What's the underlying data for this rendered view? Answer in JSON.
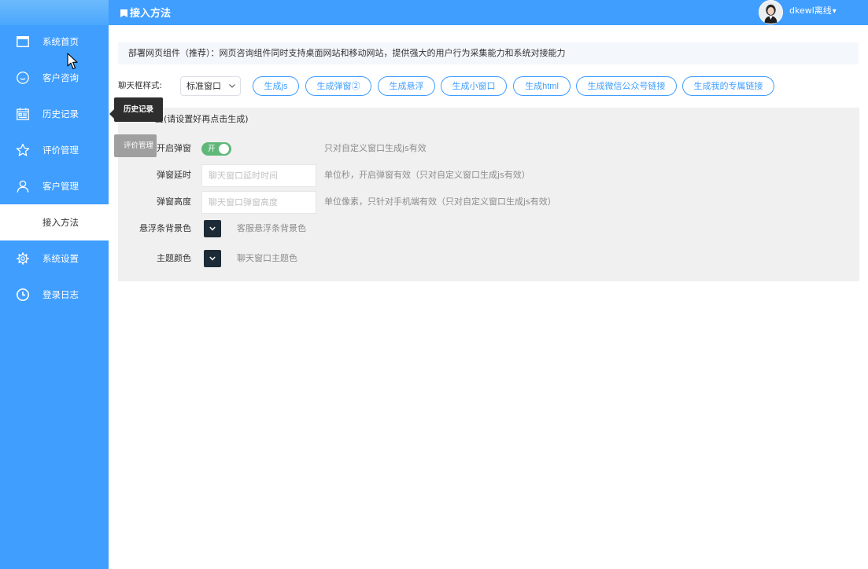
{
  "header": {
    "title": "接入方法",
    "title_icon": "bookmark-icon",
    "user_status": "dkewl离线",
    "user_menu_icon": "caret-down-icon"
  },
  "sidebar": {
    "items": [
      {
        "label": "系统首页",
        "icon": "window-icon"
      },
      {
        "label": "客户咨询",
        "icon": "smile-icon"
      },
      {
        "label": "历史记录",
        "icon": "calendar-icon"
      },
      {
        "label": "评价管理",
        "icon": "star-icon"
      },
      {
        "label": "客户管理",
        "icon": "user-icon"
      },
      {
        "label": "接入方法",
        "active": true
      },
      {
        "label": "系统设置",
        "icon": "gear-icon"
      },
      {
        "label": "登录日志",
        "icon": "clock-icon"
      }
    ]
  },
  "tooltips": {
    "history": "历史记录",
    "evaluation": "评价管理"
  },
  "notice": "部署网页组件（推荐）：网页咨询组件同时支持桌面网站和移动网站，提供强大的用户行为采集能力和系统对接能力",
  "chat_style": {
    "label": "聊天框样式:",
    "selected": "标准窗口",
    "icon": "chevron-down-icon"
  },
  "generate_buttons": [
    "生成js",
    "生成弹窗②",
    "生成悬浮",
    "生成小窗口",
    "生成html",
    "生成微信公众号链接",
    "生成我的专属链接"
  ],
  "settings": {
    "title": "置(请设置好再点击生成)",
    "popup_toggle": {
      "label": "开启弹窗",
      "state_text": "开",
      "on": true,
      "hint": "只对自定义窗口生成js有效"
    },
    "popup_delay": {
      "label": "弹窗延时",
      "placeholder": "聊天窗口延时时间",
      "hint": "单位秒，开启弹窗有效（只对自定义窗口生成js有效）"
    },
    "popup_height": {
      "label": "弹窗高度",
      "placeholder": "聊天窗口弹窗高度",
      "hint": "单位像素，只针对手机端有效（只对自定义窗口生成js有效）"
    },
    "float_bar_color": {
      "label": "悬浮条背景色",
      "color": "#1c2b36",
      "hint": "客服悬浮条背景色"
    },
    "theme_color": {
      "label": "主题颜色",
      "color": "#1c2b36",
      "hint": "聊天窗口主题色"
    }
  },
  "colors": {
    "primary": "#409eff",
    "toggle_on": "#5fb878",
    "panel_bg": "#f0f0f0",
    "tooltip_dark": "#2e2e2e"
  }
}
